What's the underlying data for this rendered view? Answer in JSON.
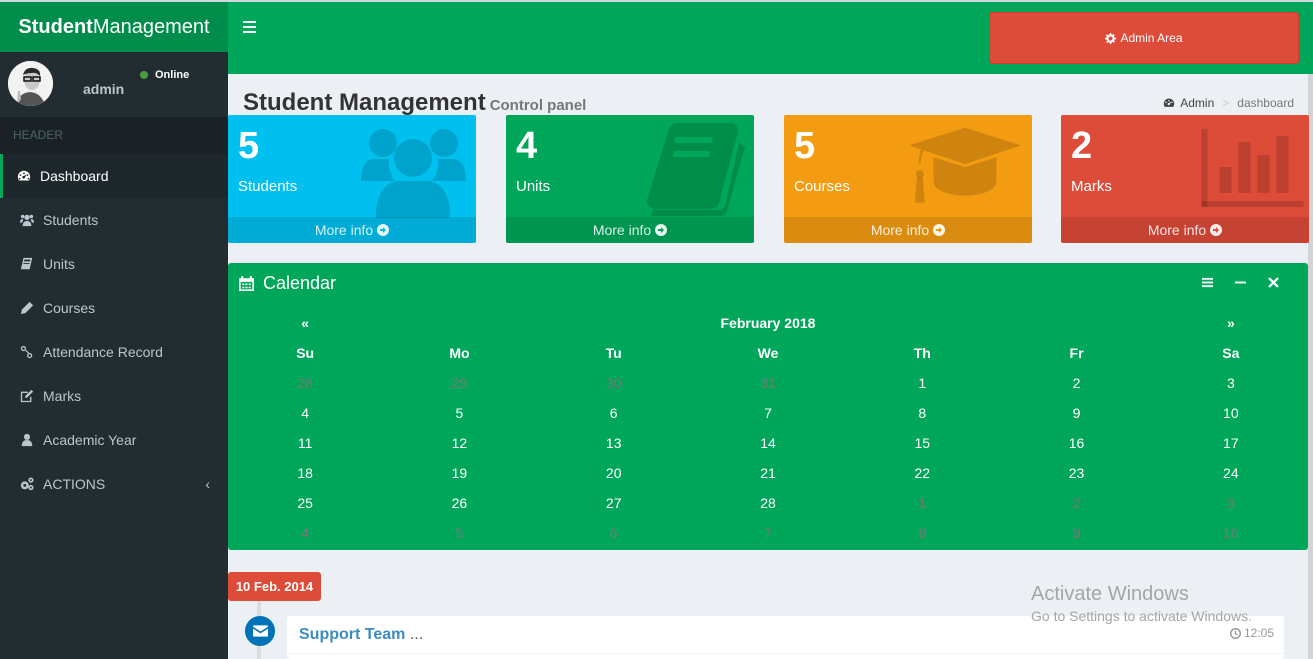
{
  "brand": {
    "bold": "Student",
    "rest": "Management"
  },
  "user": {
    "name": "admin",
    "status": "Online"
  },
  "sidebar": {
    "header": "HEADER",
    "items": [
      {
        "label": "Dashboard",
        "icon": "dashboard-icon",
        "active": true
      },
      {
        "label": "Students",
        "icon": "users-icon"
      },
      {
        "label": "Units",
        "icon": "book-icon"
      },
      {
        "label": "Courses",
        "icon": "pencil-icon"
      },
      {
        "label": "Attendance Record",
        "icon": "link-icon"
      },
      {
        "label": "Marks",
        "icon": "edit-icon"
      },
      {
        "label": "Academic Year",
        "icon": "user-icon"
      },
      {
        "label": "ACTIONS",
        "icon": "cogs-icon",
        "has_children": true
      }
    ]
  },
  "navbar": {
    "admin_button": "Admin Area"
  },
  "content": {
    "title": "Student Management",
    "subtitle": "Control panel",
    "breadcrumb": {
      "root": "Admin",
      "current": "dashboard"
    }
  },
  "stats": [
    {
      "value": "5",
      "label": "Students",
      "link": "More info",
      "color": "#00c0ef",
      "icon": "users-icon"
    },
    {
      "value": "4",
      "label": "Units",
      "link": "More info",
      "color": "#00a65a",
      "icon": "book-icon"
    },
    {
      "value": "5",
      "label": "Courses",
      "link": "More info",
      "color": "#f39c12",
      "icon": "graduation-cap-icon"
    },
    {
      "value": "2",
      "label": "Marks",
      "link": "More info",
      "color": "#dd4b39",
      "icon": "bar-chart-icon"
    }
  ],
  "calendar": {
    "title": "Calendar",
    "month": "February 2018",
    "prev": "«",
    "next": "»",
    "weekdays": [
      "Su",
      "Mo",
      "Tu",
      "We",
      "Th",
      "Fr",
      "Sa"
    ],
    "weeks": [
      [
        {
          "d": "28",
          "old": true
        },
        {
          "d": "29",
          "old": true
        },
        {
          "d": "30",
          "old": true
        },
        {
          "d": "31",
          "old": true
        },
        {
          "d": "1"
        },
        {
          "d": "2"
        },
        {
          "d": "3"
        }
      ],
      [
        {
          "d": "4"
        },
        {
          "d": "5"
        },
        {
          "d": "6"
        },
        {
          "d": "7"
        },
        {
          "d": "8"
        },
        {
          "d": "9"
        },
        {
          "d": "10"
        }
      ],
      [
        {
          "d": "11"
        },
        {
          "d": "12"
        },
        {
          "d": "13"
        },
        {
          "d": "14"
        },
        {
          "d": "15"
        },
        {
          "d": "16"
        },
        {
          "d": "17"
        }
      ],
      [
        {
          "d": "18"
        },
        {
          "d": "19"
        },
        {
          "d": "20"
        },
        {
          "d": "21"
        },
        {
          "d": "22"
        },
        {
          "d": "23"
        },
        {
          "d": "24"
        }
      ],
      [
        {
          "d": "25"
        },
        {
          "d": "26"
        },
        {
          "d": "27"
        },
        {
          "d": "28"
        },
        {
          "d": "1",
          "old": true
        },
        {
          "d": "2",
          "old": true
        },
        {
          "d": "3",
          "old": true
        }
      ],
      [
        {
          "d": "4",
          "old": true
        },
        {
          "d": "5",
          "old": true
        },
        {
          "d": "6",
          "old": true
        },
        {
          "d": "7",
          "old": true
        },
        {
          "d": "8",
          "old": true
        },
        {
          "d": "9",
          "old": true
        },
        {
          "d": "10",
          "old": true
        }
      ]
    ]
  },
  "timeline": {
    "date_label": "10 Feb. 2014",
    "item": {
      "header": "Support Team",
      "ellipsis": " ...",
      "time": "12:05"
    }
  },
  "watermark": {
    "line1": "Activate Windows",
    "line2": "Go to Settings to activate Windows."
  }
}
